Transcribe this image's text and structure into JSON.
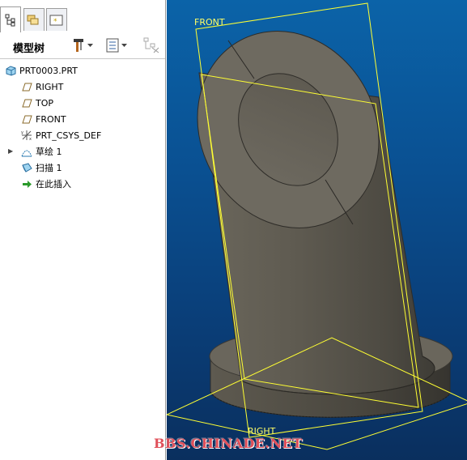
{
  "model_tree": {
    "title": "模型树",
    "items": [
      {
        "label": "PRT0003.PRT",
        "icon": "part-icon"
      },
      {
        "label": "RIGHT",
        "icon": "datum-plane-icon"
      },
      {
        "label": "TOP",
        "icon": "datum-plane-icon"
      },
      {
        "label": "FRONT",
        "icon": "datum-plane-icon"
      },
      {
        "label": "PRT_CSYS_DEF",
        "icon": "coordinate-system-icon"
      },
      {
        "label": "草绘 1",
        "icon": "sketch-icon"
      },
      {
        "label": "扫描 1",
        "icon": "sweep-icon"
      },
      {
        "label": "在此插入",
        "icon": "insert-here-arrow-icon"
      }
    ]
  },
  "tabs": [
    "model-tree-tab",
    "layer-tab",
    "favorites-tab"
  ],
  "viewport": {
    "datum_labels": {
      "front": "FRONT",
      "right": "RIGHT"
    },
    "colors": {
      "background_top": "#0b63a8",
      "background_bottom": "#0a2f5e",
      "model": "#6b675c",
      "datum": "#ffff33"
    }
  },
  "watermark": "BBS.CHINADE.NET"
}
